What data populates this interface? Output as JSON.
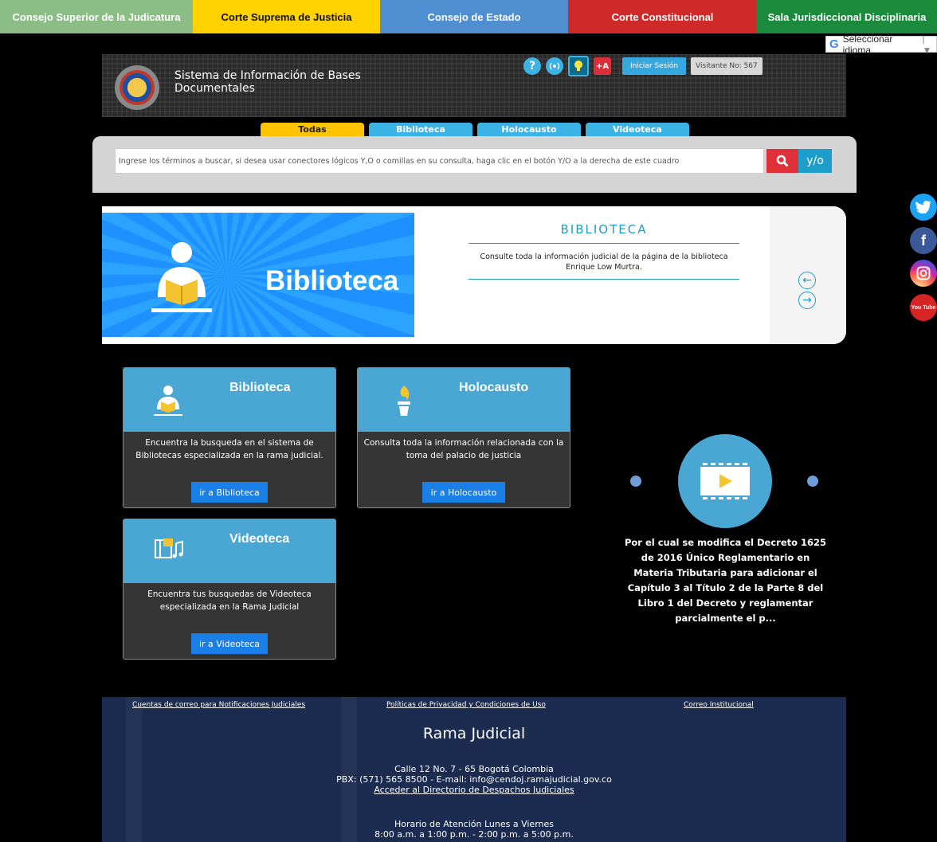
{
  "topnav": [
    "Consejo Superior de la Judicatura",
    "Corte Suprema de Justicia",
    "Consejo de Estado",
    "Corte Constitucional",
    "Sala Jurisdiccional Disciplinaria"
  ],
  "translate": {
    "label": "Seleccionar idioma"
  },
  "header": {
    "title": "Sistema de Información de Bases Documentales",
    "help": "?",
    "audio": "🔊",
    "font_plus": "+A",
    "login": "Iniciar Sesión",
    "visits": "Visitante No: 567"
  },
  "search": {
    "tabs": [
      "Todas",
      "Biblioteca",
      "Holocausto",
      "Videoteca"
    ],
    "placeholder": "Ingrese los términos a buscar, si desea usar conectores lógicos Y,O o comillas en su consulta, haga clic en el botón Y/O a la derecha de este cuadro",
    "logic_label": "y/o"
  },
  "slider": {
    "image_title": "Biblioteca",
    "title": "BIBLIOTECA",
    "text": "Consulte toda la información judicial de la página de la biblioteca Enrique Low Murtra.",
    "prev": "←",
    "next": "→"
  },
  "cards": [
    {
      "title": "Biblioteca",
      "desc": "Encuentra la busqueda en el sistema de Bibliotecas especializada en la rama judicial.",
      "button": "ir a Biblioteca"
    },
    {
      "title": "Holocausto",
      "desc": "Consulta toda la información relacionada con la toma del palacio de justicia",
      "button": "ir a Holocausto"
    },
    {
      "title": "Videoteca",
      "desc": "Encuentra tus busquedas de Videoteca especializada en la Rama Judicial",
      "button": "ir a Videoteca"
    }
  ],
  "video": {
    "text": "Por el cual se modifica el Decreto 1625 de 2016 Único Reglamentario en Materia Tributaria para adicionar el Capítulo 3 al Título 2 de la Parte 8 del Libro 1 del Decreto y reglamentar parcialmente el p..."
  },
  "social": {
    "facebook": "f",
    "youtube": "You Tube"
  },
  "footer": {
    "links": [
      "Cuentas de correo para Notificaciones Judiciales",
      "Políticas de Privacidad y Condiciones de Uso",
      "Correo Institucional"
    ],
    "title": "Rama Judicial",
    "address": "Calle 12 No. 7 - 65 Bogotá Colombia",
    "contact": "PBX: (571) 565 8500 - E-mail: info@cendoj.ramajudicial.gov.co",
    "directory": "Acceder al Directorio de Despachos Judiciales",
    "hours_title": "Horario de Atención Lunes a Viernes",
    "hours": "8:00 a.m. a 1:00 p.m. - 2:00 p.m. a 5:00 p.m."
  },
  "colors": {
    "accent": "#1d9dc9",
    "search_button": "#e0303a",
    "card_header": "#4aa6d2"
  }
}
